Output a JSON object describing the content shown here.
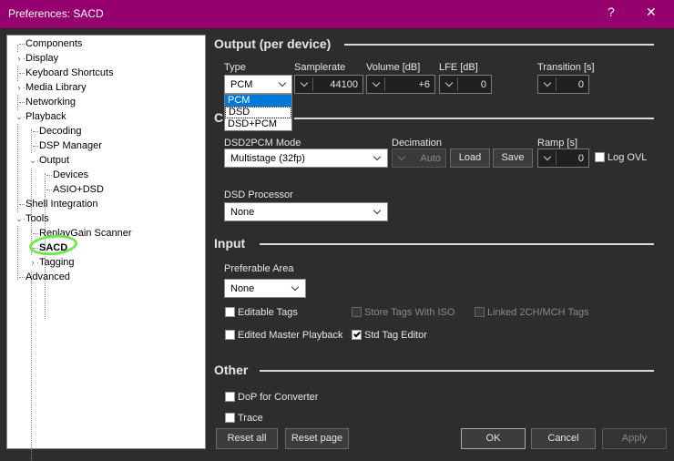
{
  "window": {
    "title": "Preferences: SACD",
    "help": "?",
    "close": "✕"
  },
  "tree": {
    "items": [
      {
        "label": "Components",
        "level": 0,
        "expander": ""
      },
      {
        "label": "Display",
        "level": 0,
        "expander": "›"
      },
      {
        "label": "Keyboard Shortcuts",
        "level": 0,
        "expander": ""
      },
      {
        "label": "Media Library",
        "level": 0,
        "expander": "›"
      },
      {
        "label": "Networking",
        "level": 0,
        "expander": ""
      },
      {
        "label": "Playback",
        "level": 0,
        "expander": "⌄"
      },
      {
        "label": "Decoding",
        "level": 1,
        "expander": ""
      },
      {
        "label": "DSP Manager",
        "level": 1,
        "expander": ""
      },
      {
        "label": "Output",
        "level": 1,
        "expander": "⌄"
      },
      {
        "label": "Devices",
        "level": 2,
        "expander": ""
      },
      {
        "label": "ASIO+DSD",
        "level": 2,
        "expander": ""
      },
      {
        "label": "Shell Integration",
        "level": 0,
        "expander": ""
      },
      {
        "label": "Tools",
        "level": 0,
        "expander": "⌄"
      },
      {
        "label": "ReplayGain Scanner",
        "level": 1,
        "expander": ""
      },
      {
        "label": "SACD",
        "level": 1,
        "expander": "",
        "selected": true
      },
      {
        "label": "Tagging",
        "level": 1,
        "expander": "›"
      },
      {
        "label": "Advanced",
        "level": 0,
        "expander": ""
      }
    ]
  },
  "output": {
    "title": "Output (per device)",
    "type_label": "Type",
    "type_value": "PCM",
    "type_options": [
      "PCM",
      "DSD",
      "DSD+PCM"
    ],
    "samplerate_label": "Samplerate",
    "samplerate_value": "44100",
    "volume_label": "Volume [dB]",
    "volume_value": "+6",
    "lfe_label": "LFE [dB]",
    "lfe_value": "0",
    "transition_label": "Transition [s]",
    "transition_value": "0"
  },
  "conversion": {
    "title": "C",
    "mode_label": "DSD2PCM Mode",
    "mode_value": "Multistage (32fp)",
    "decimation_label": "Decimation",
    "decimation_value": "Auto",
    "load_label": "Load",
    "save_label": "Save",
    "ramp_label": "Ramp [s]",
    "ramp_value": "0",
    "log_ovl_label": "Log OVL",
    "processor_label": "DSD Processor",
    "processor_value": "None"
  },
  "input": {
    "title": "Input",
    "area_label": "Preferable Area",
    "area_value": "None",
    "editable_tags": "Editable Tags",
    "store_tags": "Store Tags With ISO",
    "linked_tags": "Linked 2CH/MCH Tags",
    "edited_master": "Edited Master Playback",
    "std_tag_editor": "Std Tag Editor"
  },
  "other": {
    "title": "Other",
    "dop": "DoP for Converter",
    "trace": "Trace"
  },
  "footer": {
    "reset_all": "Reset all",
    "reset_page": "Reset page",
    "ok": "OK",
    "cancel": "Cancel",
    "apply": "Apply"
  }
}
